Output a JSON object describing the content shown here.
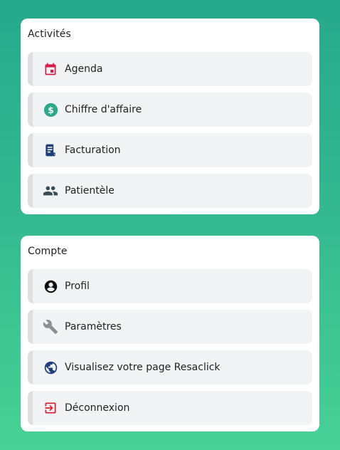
{
  "activites": {
    "title": "Activités",
    "items": [
      {
        "label": "Agenda",
        "icon": "calendar-icon",
        "color": "#d81b44"
      },
      {
        "label": "Chiffre d'affaire",
        "icon": "dollar-circle-icon",
        "color": "#2ea88a"
      },
      {
        "label": "Facturation",
        "icon": "receipt-icon",
        "color": "#1f3f7a"
      },
      {
        "label": "Patientèle",
        "icon": "people-icon",
        "color": "#3b4b55"
      }
    ]
  },
  "compte": {
    "title": "Compte",
    "items": [
      {
        "label": "Profil",
        "icon": "account-circle-icon",
        "color": "#111111"
      },
      {
        "label": "Paramètres",
        "icon": "wrench-icon",
        "color": "#8a8f94"
      },
      {
        "label": "Visualisez votre page Resaclick",
        "icon": "globe-icon",
        "color": "#1f3f7a"
      },
      {
        "label": "Déconnexion",
        "icon": "logout-icon",
        "color": "#d81b2c"
      }
    ]
  }
}
